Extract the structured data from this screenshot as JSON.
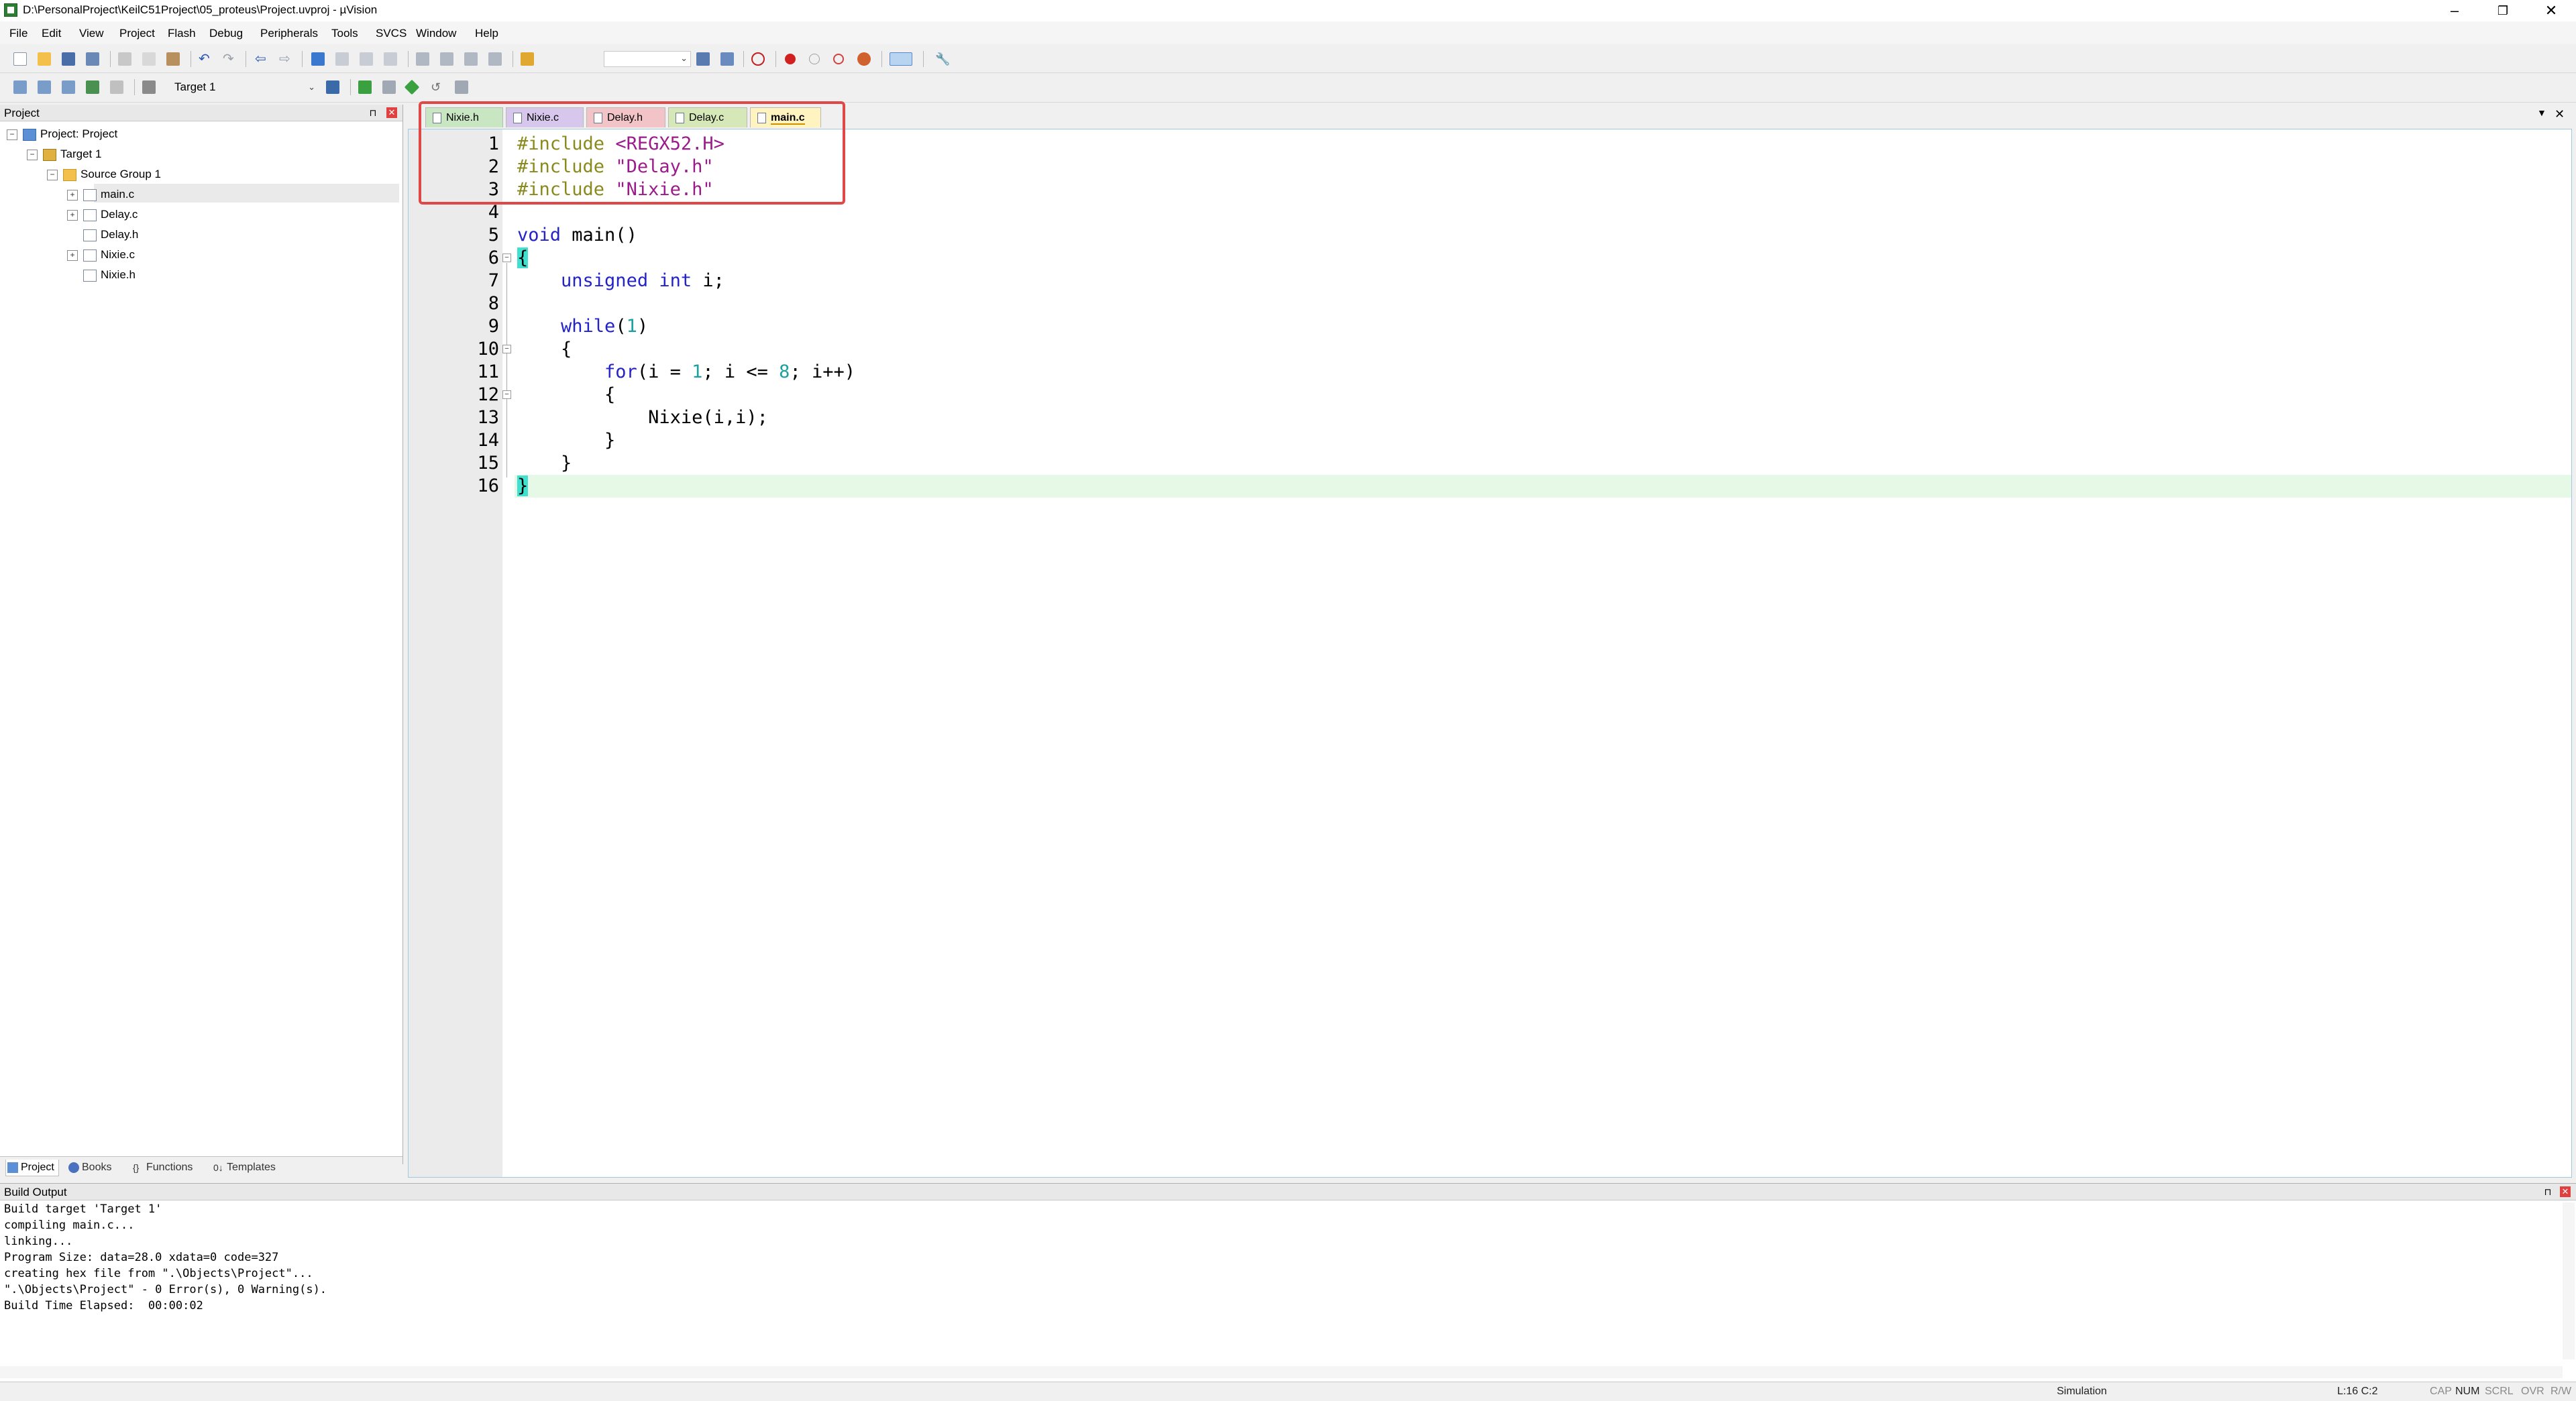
{
  "window": {
    "title": "D:\\PersonalProject\\KeilC51Project\\05_proteus\\Project.uvproj - µVision",
    "minimize": "–",
    "maximize": "❐",
    "close": "✕"
  },
  "menu": [
    "File",
    "Edit",
    "View",
    "Project",
    "Flash",
    "Debug",
    "Peripherals",
    "Tools",
    "SVCS",
    "Window",
    "Help"
  ],
  "toolbar2": {
    "target": "Target 1"
  },
  "project_panel": {
    "title": "Project",
    "tree": {
      "root": "Project: Project",
      "target": "Target 1",
      "group": "Source Group 1",
      "files": [
        "main.c",
        "Delay.c",
        "Delay.h",
        "Nixie.c",
        "Nixie.h"
      ]
    },
    "tabs": [
      "Project",
      "Books",
      "Functions",
      "Templates"
    ]
  },
  "editor": {
    "tabs": [
      "Nixie.h",
      "Nixie.c",
      "Delay.h",
      "Delay.c",
      "main.c"
    ],
    "tab_colors": [
      "#c9e6c3",
      "#d8c7ec",
      "#f2c4c8",
      "#d6e8b8",
      "#fff4c0"
    ],
    "line_numbers": [
      "1",
      "2",
      "3",
      "4",
      "5",
      "6",
      "7",
      "8",
      "9",
      "10",
      "11",
      "12",
      "13",
      "14",
      "15",
      "16"
    ],
    "code": {
      "l1_dir": "#include",
      "l1_arg": "<REGX52.H>",
      "l2_dir": "#include",
      "l2_arg": "\"Delay.h\"",
      "l3_dir": "#include",
      "l3_arg": "\"Nixie.h\"",
      "l5_kw": "void",
      "l5_rest": " main()",
      "l6": "{",
      "l7_kw": "unsigned int",
      "l7_rest": " i;",
      "l9_kw": "while",
      "l9_a": "(",
      "l9_num": "1",
      "l9_b": ")",
      "l10": "{",
      "l11_kw": "for",
      "l11_a": "(i = ",
      "l11_n1": "1",
      "l11_b": "; i <= ",
      "l11_n2": "8",
      "l11_c": "; i++)",
      "l12": "{",
      "l13": "Nixie(i,i);",
      "l14": "}",
      "l15": "}",
      "l16": "}"
    }
  },
  "build_output": {
    "title": "Build Output",
    "lines": [
      "Build target 'Target 1'",
      "compiling main.c...",
      "linking...",
      "Program Size: data=28.0 xdata=0 code=327",
      "creating hex file from \".\\Objects\\Project\"...",
      "\".\\Objects\\Project\" - 0 Error(s), 0 Warning(s).",
      "Build Time Elapsed:  00:00:02"
    ]
  },
  "status": {
    "mode": "Simulation",
    "position": "L:16 C:2",
    "cap": "CAP",
    "num": "NUM",
    "scrl": "SCRL",
    "ovr": "OVR",
    "rw": "R/W"
  }
}
